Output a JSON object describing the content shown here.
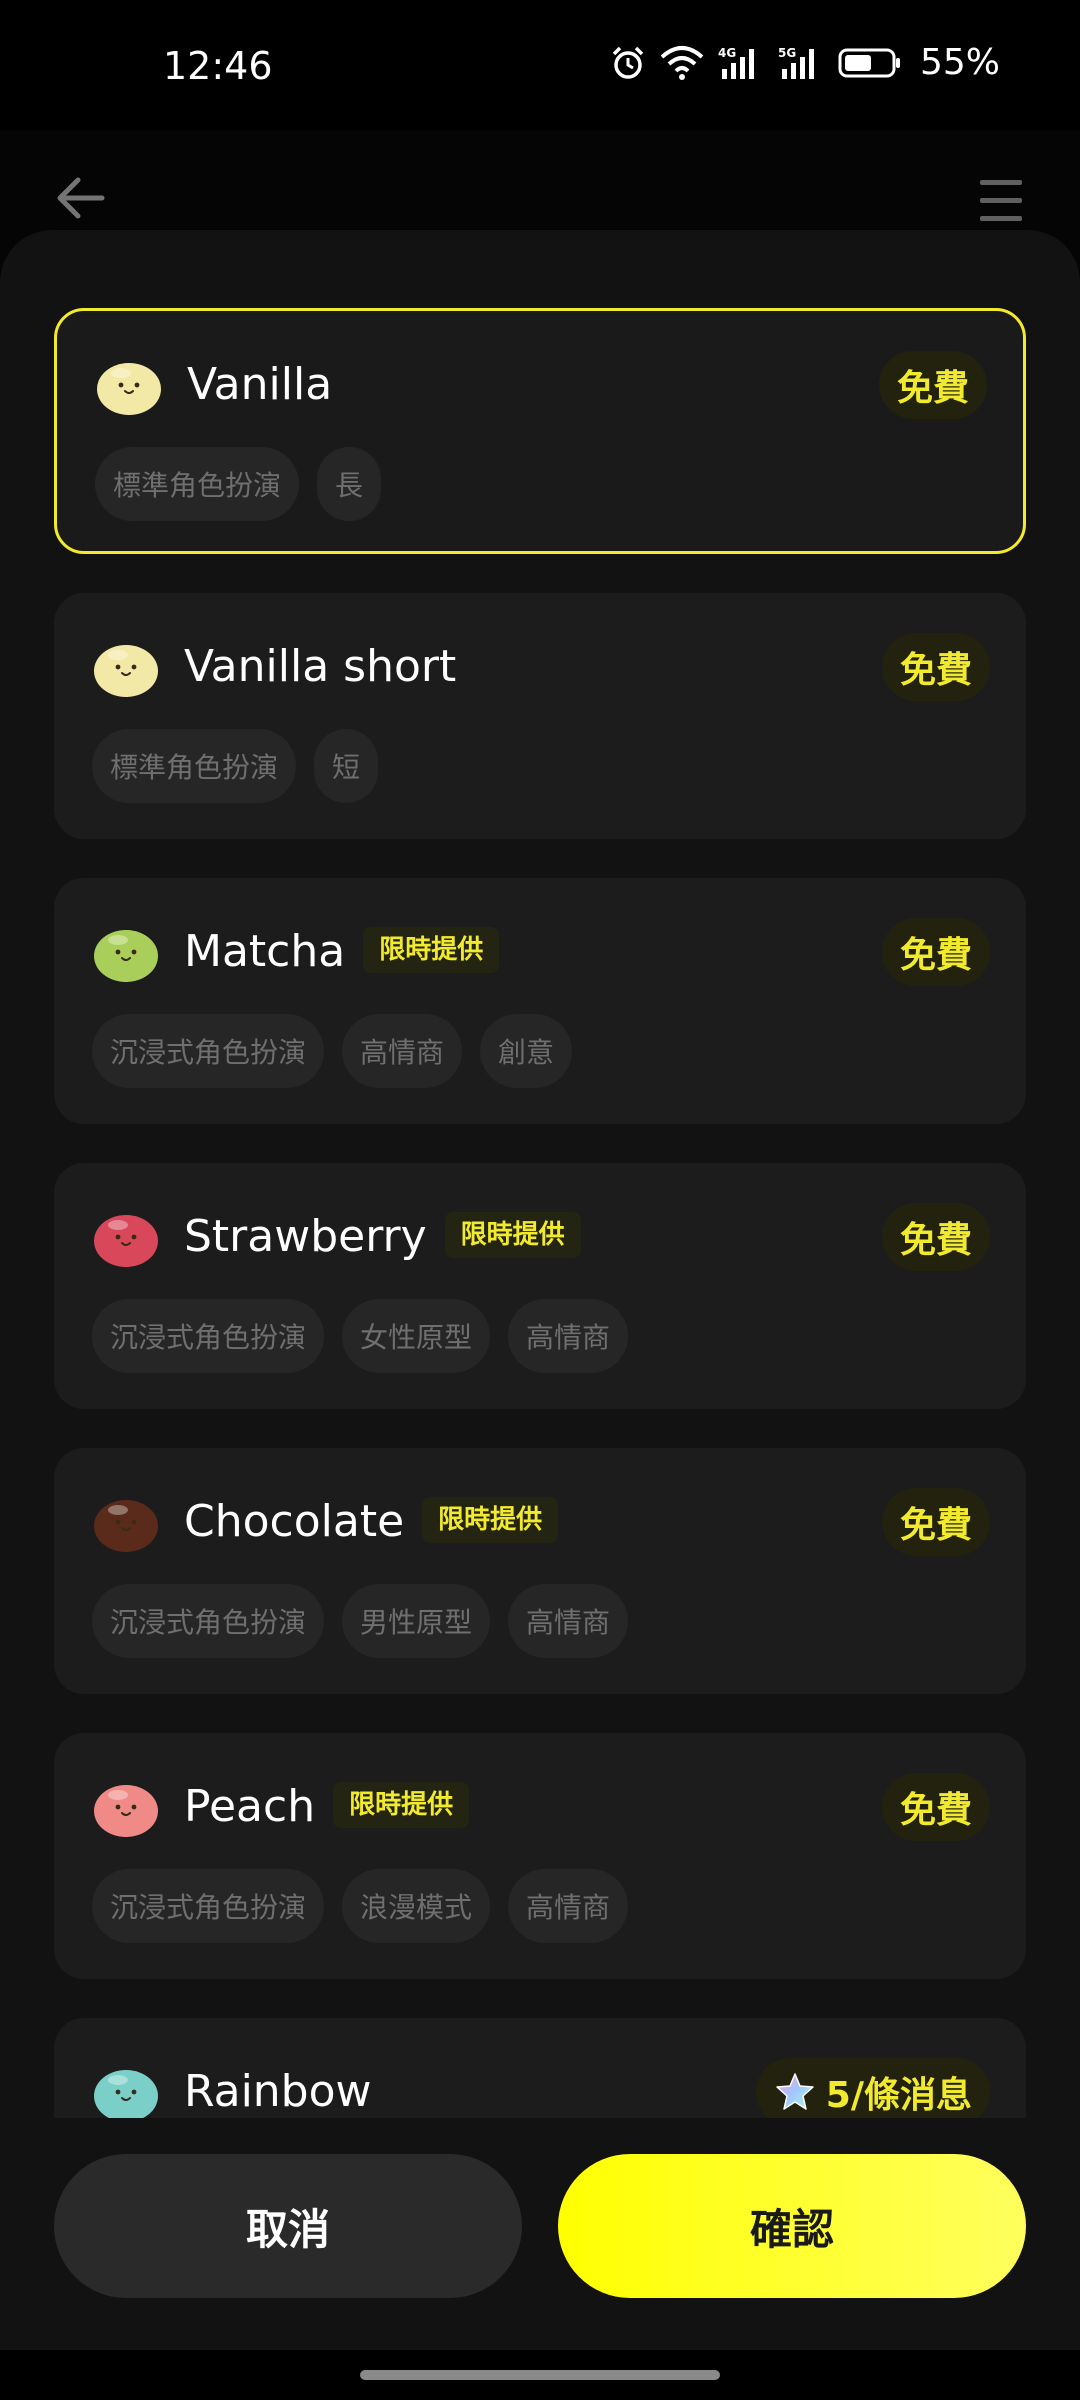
{
  "status_bar": {
    "time": "12:46",
    "battery": "55%"
  },
  "header": {},
  "models": [
    {
      "name": "Vanilla",
      "badge": "",
      "price": "免費",
      "tags": [
        "標準角色扮演",
        "長"
      ],
      "selected": true,
      "avatar_color": "#f3e9a6"
    },
    {
      "name": "Vanilla short",
      "badge": "",
      "price": "免費",
      "tags": [
        "標準角色扮演",
        "短"
      ],
      "selected": false,
      "avatar_color": "#f3e9a6"
    },
    {
      "name": "Matcha",
      "badge": "限時提供",
      "price": "免費",
      "tags": [
        "沉浸式角色扮演",
        "高情商",
        "創意"
      ],
      "selected": false,
      "avatar_color": "#a9cf5a"
    },
    {
      "name": "Strawberry",
      "badge": "限時提供",
      "price": "免費",
      "tags": [
        "沉浸式角色扮演",
        "女性原型",
        "高情商"
      ],
      "selected": false,
      "avatar_color": "#d9475b"
    },
    {
      "name": "Chocolate",
      "badge": "限時提供",
      "price": "免費",
      "tags": [
        "沉浸式角色扮演",
        "男性原型",
        "高情商"
      ],
      "selected": false,
      "avatar_color": "#5a2a1a"
    },
    {
      "name": "Peach",
      "badge": "限時提供",
      "price": "免費",
      "tags": [
        "沉浸式角色扮演",
        "浪漫模式",
        "高情商"
      ],
      "selected": false,
      "avatar_color": "#f08a86"
    },
    {
      "name": "Rainbow",
      "badge": "",
      "price": "5/條消息",
      "tags": [],
      "selected": false,
      "avatar_color": "#7ad0c8",
      "price_icon": "star-icon"
    }
  ],
  "footer": {
    "cancel_label": "取消",
    "confirm_label": "確認"
  },
  "colors": {
    "accent": "#f2ea2c",
    "background": "#121212",
    "card": "#1c1c1c"
  }
}
